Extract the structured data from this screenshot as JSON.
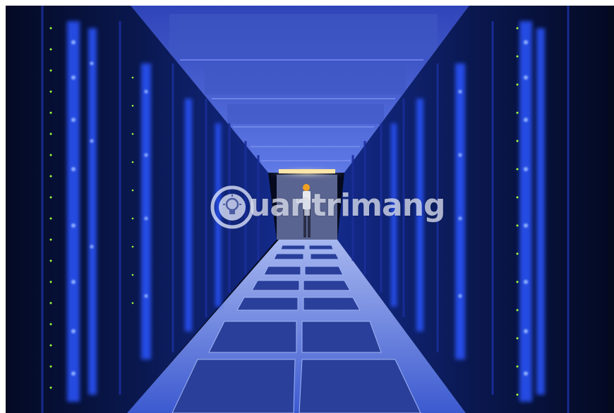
{
  "image": {
    "subject": "server-room-corridor"
  },
  "watermark": {
    "text": "uantrimang",
    "icon": "lightbulb-icon"
  },
  "colors": {
    "rack_glow": "#1f4cff",
    "floor": "#5a78d8",
    "ceiling": "#3a54c8",
    "status_led": "#9cff3a",
    "end_light": "#ffe6a8"
  }
}
